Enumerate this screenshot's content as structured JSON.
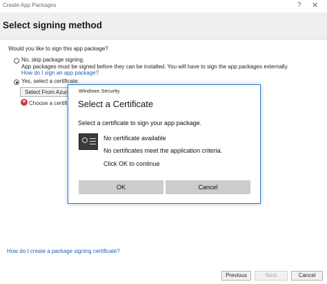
{
  "window": {
    "title": "Create App Packages",
    "help_glyph": "?",
    "close_glyph": "✕"
  },
  "header": {
    "heading": "Select signing method"
  },
  "form": {
    "question": "Would you like to sign this app package?",
    "option_no": {
      "label": "No, skip package signing.",
      "description": "App packages must be signed before they can be installed. You will have to sign the app packages externally.",
      "link": "How do I sign an app package?",
      "selected": false
    },
    "option_yes": {
      "label": "Yes, select a certificate:",
      "selected": true
    },
    "select_azure_button": "Select From Azure",
    "error_text": "Choose a certifica"
  },
  "help_link": "How do I create a package signing certificate?",
  "footer": {
    "previous": "Previous",
    "next": "Next",
    "cancel": "Cancel"
  },
  "dialog": {
    "small_title": "Windows Security",
    "heading": "Select a Certificate",
    "instruction": "Select a certificate to sign your app package.",
    "message_line1": "No certificate available",
    "message_line2": "No certificates meet the application criteria.",
    "message_line3": "Click OK to continue",
    "ok_button": "OK",
    "cancel_button": "Cancel"
  },
  "colors": {
    "dialog_border": "#1f78d1",
    "link": "#1d5fb4",
    "error": "#d13438"
  }
}
